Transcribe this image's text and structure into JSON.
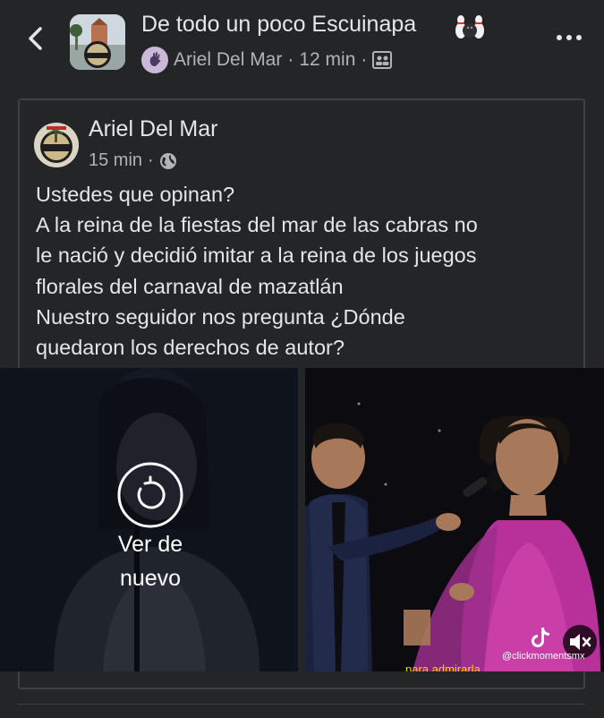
{
  "header": {
    "group_name": "De todo un poco Escuinapa",
    "poster_name": "Ariel Del Mar",
    "time": "12 min",
    "separator": "·",
    "icons": [
      "back-arrow-icon",
      "bowling-pins-icon",
      "anonymous-member-icon",
      "members-icon",
      "more-icon"
    ]
  },
  "post": {
    "author": "Ariel Del Mar",
    "time": "15 min",
    "separator": "·",
    "privacy_icon": "globe-icon",
    "text_lines": [
      "Ustedes que opinan?",
      "A la reina de la fiestas del mar de las cabras  no",
      "le nació y decidió imitar a la reina de los juegos",
      "florales del carnaval de mazatlán",
      "Nuestro seguidor nos pregunta ¿Dónde",
      "quedaron los derechos de autor?"
    ]
  },
  "media": {
    "replay_line1": "Ver de",
    "replay_line2": "nuevo",
    "handle": "@clickmomentsmx",
    "caption": "para admirarla"
  },
  "colors": {
    "background": "#242526",
    "text_primary": "#e4e6eb",
    "text_secondary": "#b0b3b8",
    "border": "#3e4042",
    "gown": "#b8309a"
  }
}
